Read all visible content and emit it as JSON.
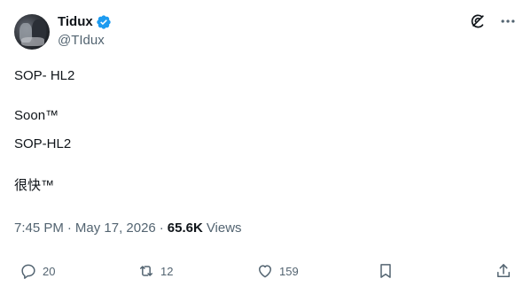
{
  "author": {
    "name": "Tidux",
    "handle": "@TIdux"
  },
  "post": {
    "lines": [
      "SOP- HL2",
      "Soon™",
      "SOP-HL2",
      "很快™"
    ],
    "time": "7:45 PM",
    "separator_1": "·",
    "date": "May 17, 2026",
    "separator_2": "·",
    "views_count": "65.6K",
    "views_label": "Views"
  },
  "actions": {
    "replies": "20",
    "reposts": "12",
    "likes": "159"
  },
  "icons": {
    "verified": "verified-badge-icon",
    "grok": "grok-icon",
    "more": "more-icon",
    "reply": "reply-icon",
    "repost": "repost-icon",
    "like": "like-icon",
    "bookmark": "bookmark-icon",
    "share": "share-icon"
  },
  "colors": {
    "accent": "#1d9bf0",
    "text": "#0f1419",
    "muted": "#536471"
  }
}
